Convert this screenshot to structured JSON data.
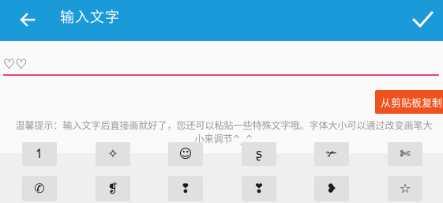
{
  "appbar": {
    "title": "输入文字",
    "back_icon": "arrow-left-icon",
    "confirm_icon": "check-icon",
    "color": "#1a9ad9"
  },
  "editor": {
    "value": "♡♡",
    "underline_color": "#e8456b"
  },
  "copy_button": {
    "label": "从剪贴板复制",
    "color": "#f0521e"
  },
  "hint": "温馨提示：输入文字后直接画就好了，您还可以粘贴一些特殊文字哦。字体大小可以通过改变画笔大小来调节^_^",
  "symbols": {
    "row1": [
      "↿",
      "✧",
      "☺",
      "ʂ",
      "✃",
      "✄"
    ],
    "row2": [
      "✆",
      "❡",
      "❢",
      "❣",
      "❥",
      "☆"
    ]
  }
}
